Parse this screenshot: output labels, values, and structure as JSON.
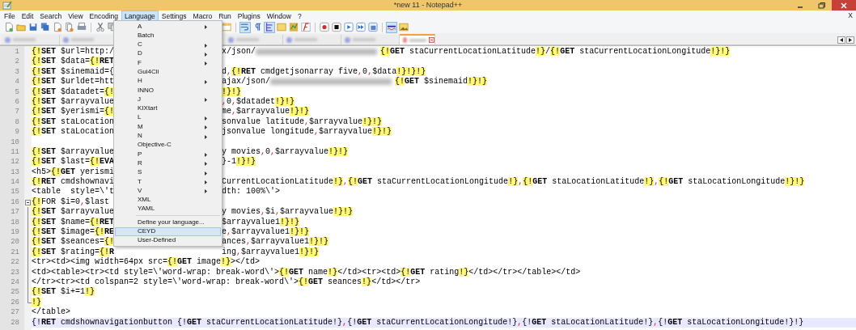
{
  "window": {
    "title": "*new 11 - Notepad++"
  },
  "menu_bar": [
    {
      "label": "File",
      "selected": false
    },
    {
      "label": "Edit",
      "selected": false
    },
    {
      "label": "Search",
      "selected": false
    },
    {
      "label": "View",
      "selected": false
    },
    {
      "label": "Encoding",
      "selected": false
    },
    {
      "label": "Language",
      "selected": true
    },
    {
      "label": "Settings",
      "selected": false
    },
    {
      "label": "Macro",
      "selected": false
    },
    {
      "label": "Run",
      "selected": false
    },
    {
      "label": "Plugins",
      "selected": false
    },
    {
      "label": "Window",
      "selected": false
    },
    {
      "label": "?",
      "selected": false
    }
  ],
  "document_close": "X",
  "toolbar": [
    {
      "pressed": false
    },
    {
      "pressed": false
    },
    {
      "pressed": false
    },
    {
      "pressed": false
    },
    {
      "pressed": false
    },
    {
      "pressed": false
    },
    {
      "pressed": false
    },
    {
      "pressed": false
    },
    {
      "pressed": false
    },
    {
      "pressed": false
    },
    {
      "pressed": true
    },
    {
      "pressed": false
    },
    {
      "pressed": true
    },
    {
      "pressed": false
    },
    {
      "pressed": false
    },
    {
      "pressed": false
    },
    {
      "pressed": false
    },
    {
      "pressed": false
    },
    {
      "pressed": false
    },
    {
      "pressed": false
    },
    {
      "pressed": false
    },
    {
      "pressed": true
    },
    {
      "pressed": false
    }
  ],
  "tabs": [
    {
      "selected": false
    },
    {
      "selected": false
    },
    {
      "selected": false
    },
    {
      "selected": false
    },
    {
      "selected": false
    },
    {
      "selected": true
    }
  ],
  "language_menu": [
    {
      "kind": "item",
      "label": "A",
      "submenu": true,
      "selected": false
    },
    {
      "kind": "item",
      "label": "Batch",
      "submenu": false,
      "selected": false
    },
    {
      "kind": "item",
      "label": "C",
      "submenu": true,
      "selected": false
    },
    {
      "kind": "item",
      "label": "D",
      "submenu": true,
      "selected": false
    },
    {
      "kind": "item",
      "label": "F",
      "submenu": true,
      "selected": false
    },
    {
      "kind": "item",
      "label": "Gui4Cli",
      "submenu": false,
      "selected": false
    },
    {
      "kind": "item",
      "label": "H",
      "submenu": true,
      "selected": false
    },
    {
      "kind": "item",
      "label": "INNO",
      "submenu": false,
      "selected": false
    },
    {
      "kind": "item",
      "label": "J",
      "submenu": true,
      "selected": false
    },
    {
      "kind": "item",
      "label": "KIXtart",
      "submenu": false,
      "selected": false
    },
    {
      "kind": "item",
      "label": "L",
      "submenu": true,
      "selected": false
    },
    {
      "kind": "item",
      "label": "M",
      "submenu": true,
      "selected": false
    },
    {
      "kind": "item",
      "label": "N",
      "submenu": true,
      "selected": false
    },
    {
      "kind": "item",
      "label": "Objective-C",
      "submenu": false,
      "selected": false
    },
    {
      "kind": "item",
      "label": "P",
      "submenu": true,
      "selected": false
    },
    {
      "kind": "item",
      "label": "R",
      "submenu": true,
      "selected": false
    },
    {
      "kind": "item",
      "label": "S",
      "submenu": true,
      "selected": false
    },
    {
      "kind": "item",
      "label": "T",
      "submenu": true,
      "selected": false
    },
    {
      "kind": "item",
      "label": "V",
      "submenu": true,
      "selected": false
    },
    {
      "kind": "item",
      "label": "XML",
      "submenu": false,
      "selected": false
    },
    {
      "kind": "item",
      "label": "YAML",
      "submenu": false,
      "selected": false
    },
    {
      "kind": "separator"
    },
    {
      "kind": "item",
      "label": "Define your language...",
      "submenu": false,
      "selected": false
    },
    {
      "kind": "item",
      "label": "CEYD",
      "submenu": false,
      "selected": true
    },
    {
      "kind": "item",
      "label": "User-Defined",
      "submenu": false,
      "selected": false
    }
  ],
  "editor": {
    "lines": [
      {
        "number": "1",
        "left": "{!**SET** $url=http:/",
        "right": [
          {
            "kind": "code",
            "text": "x/json/"
          },
          {
            "kind": "blurred"
          },
          {
            "kind": "code",
            "text": "{!**GET** staCurrentLocationLatitude!}/{!**GET** staCurrentLocationLongitude!}!}"
          }
        ],
        "current": false
      },
      {
        "number": "2",
        "left": "{!**SET** $data={!**RET**",
        "current": false
      },
      {
        "number": "3",
        "left": "{!**SET** $sinemaid={",
        "right": [
          {
            "kind": "code",
            "text": "d,{!**RET** cmdgetjsonarray five,0,$data!}!}!}"
          }
        ],
        "current": false
      },
      {
        "number": "4",
        "left": "{!**SET** $urldet=htt",
        "right": [
          {
            "kind": "code",
            "text": "ajax/json/"
          },
          {
            "kind": "blurred"
          },
          {
            "kind": "code",
            "text": "{!**GET** $sinemaid!}!}"
          }
        ],
        "current": false
      },
      {
        "number": "5",
        "left": "{!**SET** $datadet={!",
        "right": [
          {
            "kind": "code",
            "text": "!}!}"
          }
        ],
        "current": false
      },
      {
        "number": "6",
        "left": "{!**SET** $arrayvalue",
        "right": [
          {
            "kind": "code",
            "text": ",0,$datadet!}!}"
          }
        ],
        "current": false
      },
      {
        "number": "7",
        "left": "{!**SET** $yerismi={!",
        "right": [
          {
            "kind": "code",
            "text": "me,$arrayvalue!}!}"
          }
        ],
        "current": false
      },
      {
        "number": "8",
        "left": "{!**SET** staLocation",
        "right": [
          {
            "kind": "code",
            "text": "sonvalue latitude,$arrayvalue!}!}"
          }
        ],
        "current": false
      },
      {
        "number": "9",
        "left": "{!**SET** staLocation",
        "right": [
          {
            "kind": "code",
            "text": "jsonvalue longitude,$arrayvalue!}!}"
          }
        ],
        "current": false
      },
      {
        "number": "10",
        "current": false
      },
      {
        "number": "11",
        "left": "{!**SET** $arrayvalue",
        "right": [
          {
            "kind": "code",
            "text": "y movies,0,$arrayvalue!}!}"
          }
        ],
        "current": false
      },
      {
        "number": "12",
        "left": "{!**SET** $last={!**EVA**",
        "right": [
          {
            "kind": "code",
            "text": "}-1!}!}"
          }
        ],
        "current": false
      },
      {
        "number": "13",
        "left": "<h5>{!**GET** yerismi",
        "current": false
      },
      {
        "number": "14",
        "left": "{!**RET** cmdshownavi",
        "right": [
          {
            "kind": "code",
            "text": "CurrentLocationLatitude!},{!**GET** staCurrentLocationLongitude!},{!**GET** staLocationLatitude!},{!**GET** staLocationLongitude!}!}"
          }
        ],
        "current": false
      },
      {
        "number": "15",
        "left": "<table  style=\\'t",
        "right": [
          {
            "kind": "code",
            "text": "dth: 100%\\'>"
          }
        ],
        "current": false
      },
      {
        "number": "16",
        "left": "{!FOR $i=0,$last",
        "current": false,
        "fold_start": true
      },
      {
        "number": "17",
        "left": "{!**SET** $arrayvalue",
        "right": [
          {
            "kind": "code",
            "text": "y movies,$i,$arrayvalue!}!}"
          }
        ],
        "current": false,
        "in_fold": true
      },
      {
        "number": "18",
        "left": "{!**SET** $name={!**RET**",
        "right": [
          {
            "kind": "code",
            "text": "$arrayvalue1!}!}"
          }
        ],
        "current": false,
        "in_fold": true
      },
      {
        "number": "19",
        "left": "{!**SET** $image={!**RE**",
        "right": [
          {
            "kind": "code",
            "text": "e,$arrayvalue1!}!}"
          }
        ],
        "current": false,
        "in_fold": true
      },
      {
        "number": "20",
        "left": "{!**SET** $seances={!",
        "right": [
          {
            "kind": "code",
            "text": "ances,$arrayvalue1!}!}"
          }
        ],
        "current": false,
        "in_fold": true
      },
      {
        "number": "21",
        "left": "{!**SET** $rating={!**R**",
        "right": [
          {
            "kind": "code",
            "text": "ing,$arrayvalue1!}!}"
          }
        ],
        "current": false,
        "in_fold": true
      },
      {
        "number": "22",
        "full": "<tr><td><img width=64px src={!**GET** image!}></td>",
        "current": false,
        "in_fold": true
      },
      {
        "number": "23",
        "full": "<td><table><tr><td style=\\'word-wrap: break-word\\'>{!**GET** name!}</td><tr><td>{!**GET** rating!}</td></tr></table></td>",
        "current": false,
        "in_fold": true
      },
      {
        "number": "24",
        "full": "</tr><tr><td colspan=2 style=\\'word-wrap: break-word\\'>{!**GET** seances!}</td></tr>",
        "current": false,
        "in_fold": true
      },
      {
        "number": "25",
        "full": "{!**SET** $i+=1!}",
        "current": false,
        "in_fold": true
      },
      {
        "number": "26",
        "full": "!}",
        "current": false,
        "fold_end": true
      },
      {
        "number": "27",
        "full": "</table>",
        "current": false
      },
      {
        "number": "28",
        "full": "{!**RET** cmdshownavigationbutton {!**GET** staCurrentLocationLatitude!},{!**GET** staCurrentLocationLongitude!},{!**GET** staLocationLatitude!},{!**GET** staLocationLongitude!}!}",
        "current": true
      }
    ]
  }
}
